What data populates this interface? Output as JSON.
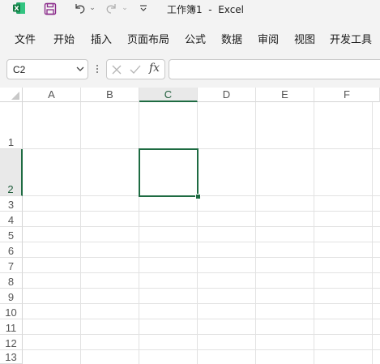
{
  "title_bar": {
    "title": "工作簿1  -  Excel",
    "icons": [
      "excel-icon",
      "save-icon",
      "undo-icon",
      "redo-icon",
      "customize-toolbar-icon"
    ]
  },
  "ribbon": {
    "tabs": [
      "文件",
      "开始",
      "插入",
      "页面布局",
      "公式",
      "数据",
      "审阅",
      "视图",
      "开发工具"
    ]
  },
  "formula_bar": {
    "name_box_value": "C2",
    "fx_label": "fx",
    "formula_value": ""
  },
  "sheet": {
    "columns": [
      "A",
      "B",
      "C",
      "D",
      "E",
      "F"
    ],
    "rows": [
      "1",
      "2",
      "3",
      "4",
      "5",
      "6",
      "7",
      "8",
      "9",
      "10",
      "11",
      "12",
      "13"
    ],
    "selected_cell": "C2",
    "accent_color": "#1e6b42"
  }
}
